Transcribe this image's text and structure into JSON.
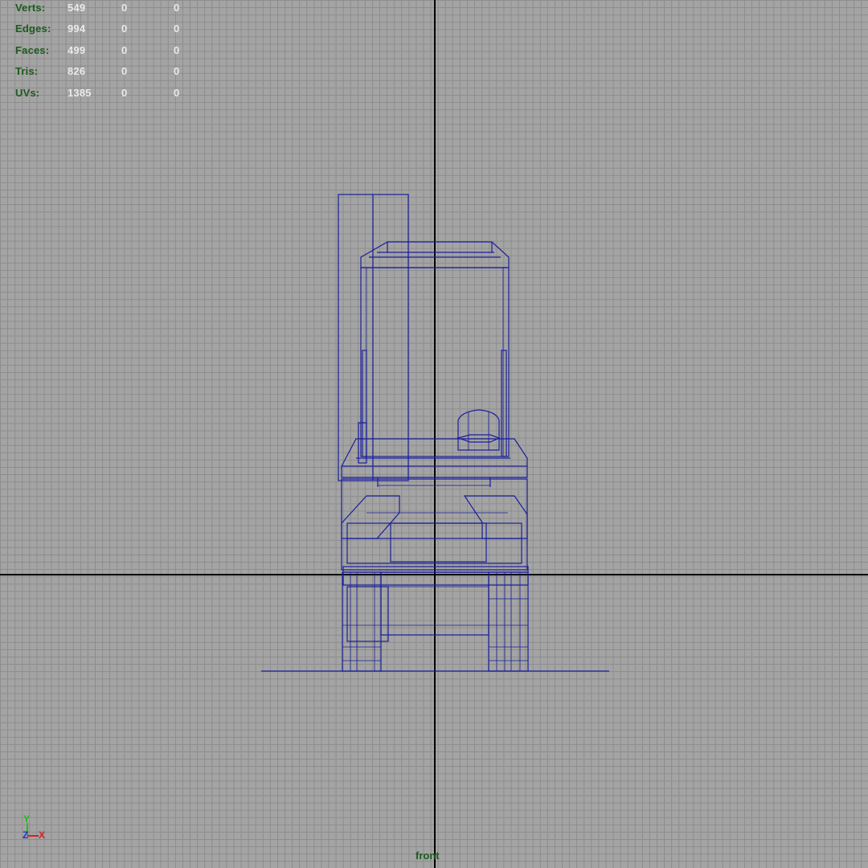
{
  "hud": {
    "rows": [
      {
        "label": "Verts:",
        "values": [
          "549",
          "0",
          "0"
        ]
      },
      {
        "label": "Edges:",
        "values": [
          "994",
          "0",
          "0"
        ]
      },
      {
        "label": "Faces:",
        "values": [
          "499",
          "0",
          "0"
        ]
      },
      {
        "label": "Tris:",
        "values": [
          "826",
          "0",
          "0"
        ]
      },
      {
        "label": "UVs:",
        "values": [
          "1385",
          "0",
          "0"
        ]
      }
    ]
  },
  "view": {
    "camera_label": "front"
  },
  "axis_gizmo": {
    "y_label": "Y",
    "z_label": "Z",
    "x_label": "X",
    "colors": {
      "x": "#d42020",
      "y": "#1fbf1f",
      "z": "#2a2ad8"
    }
  },
  "colors": {
    "background": "#a4a4a4",
    "grid": "#8c8c8c",
    "wireframe": "#1a1f9a",
    "hud_label": "#1d5a1d",
    "hud_value": "#eaeaea",
    "axis": "#000000"
  }
}
